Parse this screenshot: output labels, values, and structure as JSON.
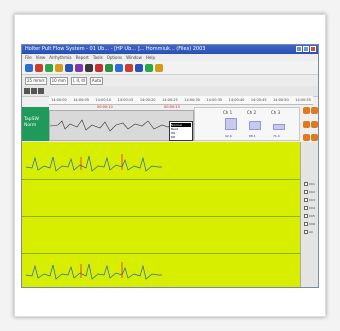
{
  "window": {
    "title": "Holter Pult Flow System - 01 Ub... - [HP Ub... ]... Hommiuk... (Files) 2003"
  },
  "menu": [
    "File",
    "View",
    "Arrhythmia",
    "Report",
    "Tools",
    "Options",
    "Window",
    "Help"
  ],
  "toolbar": {
    "tools": [
      {
        "name": "lead-icon",
        "color": "#2d6fd1"
      },
      {
        "name": "filter-icon",
        "color": "#c83f2c"
      },
      {
        "name": "arrow-icon",
        "color": "#29a84a"
      },
      {
        "name": "wave-icon",
        "color": "#d49b17"
      },
      {
        "name": "hand-icon",
        "color": "#2b53b5"
      },
      {
        "name": "magnify-icon",
        "color": "#7a3aad"
      },
      {
        "name": "print-icon",
        "color": "#3a3a3a"
      },
      {
        "name": "zoom-in-icon",
        "color": "#c73030"
      },
      {
        "name": "zoom-out-icon",
        "color": "#2f8f3f"
      },
      {
        "name": "grid-icon",
        "color": "#2d6fd1"
      },
      {
        "name": "marker-icon",
        "color": "#c83f2c"
      },
      {
        "name": "chart-icon",
        "color": "#2b53b5"
      },
      {
        "name": "flag-icon",
        "color": "#29a84a"
      },
      {
        "name": "settings-icon",
        "color": "#d49b17"
      }
    ],
    "speed_field": "25 mm/s",
    "gain_field": "10 mm",
    "lead_field": "I, II, III",
    "mode_field": "Auto"
  },
  "timeline": {
    "ticks": [
      "14:00:00",
      "14:00:05",
      "14:00:10",
      "14:00:15",
      "14:00:20",
      "14:00:25",
      "14:00:30",
      "14:00:35",
      "14:00:40",
      "14:00:45",
      "14:00:50",
      "14:00:55"
    ],
    "red_marks": [
      "00:00:10",
      "00:00:13"
    ]
  },
  "left_label": {
    "line1": "TapSW",
    "line2": "Norm"
  },
  "popup": {
    "lines": [
      "Beat",
      "HR",
      "RR",
      "QRS",
      "ST"
    ],
    "highlight": "Normal"
  },
  "stats": {
    "labels": [
      "Ch 1",
      "Ch 2",
      "Ch 3"
    ],
    "bar_levels": [
      0.6,
      0.45,
      0.3
    ],
    "values": [
      "92.6",
      "88.1",
      "71.4"
    ]
  },
  "right_panel": {
    "items": [
      "Ch1",
      "Ch2",
      "Ch3",
      "Ch4",
      "Ch5",
      "Ch6",
      "All"
    ]
  },
  "colors": {
    "accent": "#2a4fb3",
    "trace_area": "#d8ee00",
    "label_green": "#1f9a5a"
  }
}
